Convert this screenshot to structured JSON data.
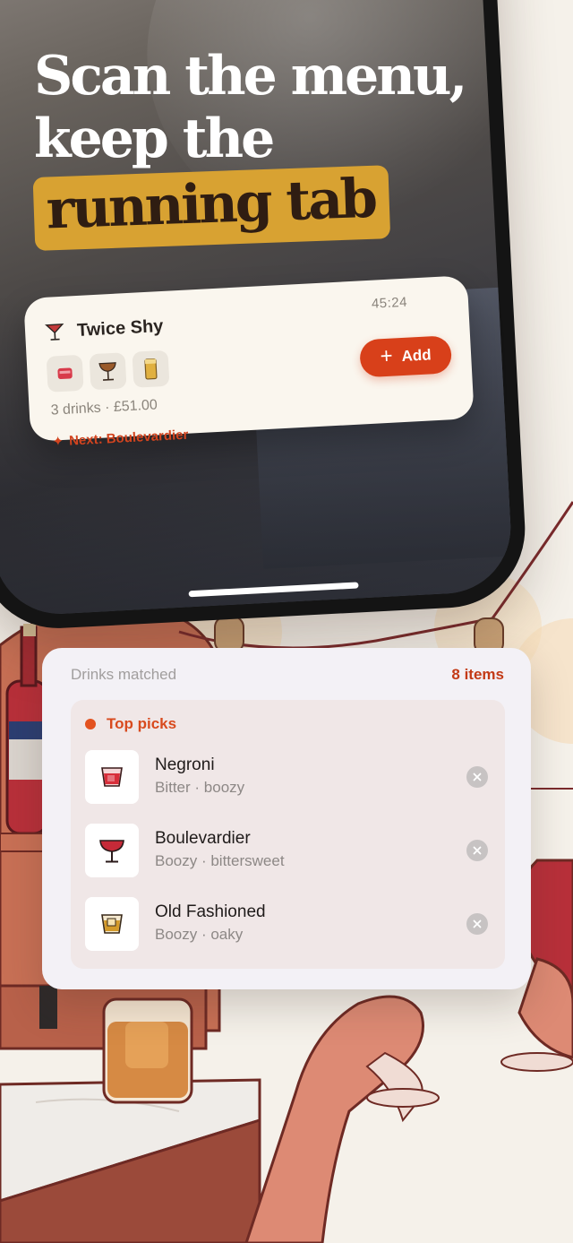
{
  "headline": {
    "line1": "Scan the menu,",
    "line2": "keep the",
    "highlight": "running tab"
  },
  "tab_card": {
    "venue": "Twice Shy",
    "venue_icon": "cocktail-glass-icon",
    "timer": "45:24",
    "drink_thumbs": [
      "negroni-glass-icon",
      "coupe-glass-icon",
      "highball-glass-icon"
    ],
    "summary": "3 drinks · £51.00",
    "next_label": "Next: Boulevardier",
    "next_icon": "sparkle-icon",
    "add_label": "Add",
    "accent": "#d8401a"
  },
  "matched": {
    "title": "Drinks matched",
    "count": "8 items",
    "section_label": "Top picks",
    "drinks": [
      {
        "name": "Negroni",
        "desc": "Bitter · boozy",
        "icon": "rocks-glass-red-icon"
      },
      {
        "name": "Boulevardier",
        "desc": "Boozy · bittersweet",
        "icon": "coupe-glass-icon"
      },
      {
        "name": "Old Fashioned",
        "desc": "Boozy · oaky",
        "icon": "rocks-glass-amber-icon"
      }
    ]
  },
  "colors": {
    "highlight": "#d8a232",
    "accent": "#c33a16",
    "background": "#f5f1ea"
  }
}
